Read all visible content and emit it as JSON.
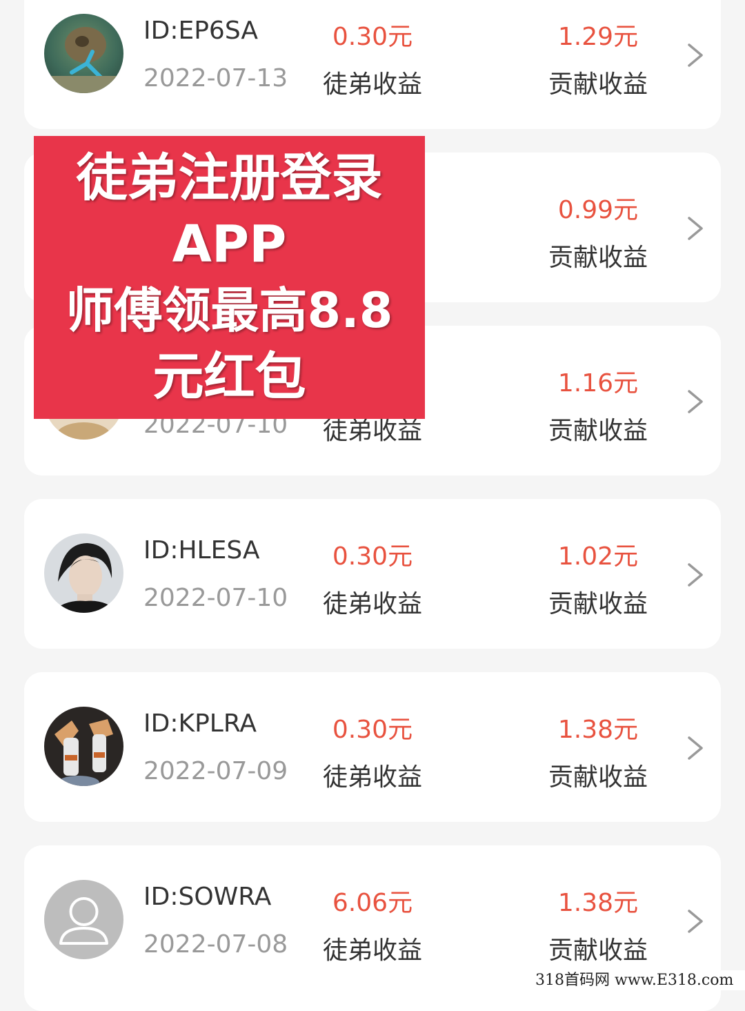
{
  "records": [
    {
      "id": "ID:EP6SA",
      "date": "2022-07-13",
      "apprentice_amount": "0.30元",
      "apprentice_label": "徒弟收益",
      "contribution_amount": "1.29元",
      "contribution_label": "贡献收益",
      "avatar": "coral-reef-photo"
    },
    {
      "id": "",
      "date": "",
      "apprentice_amount": "",
      "apprentice_label": "",
      "contribution_amount": "0.99元",
      "contribution_label": "贡献收益",
      "avatar": "hidden"
    },
    {
      "id": "",
      "date": "2022-07-10",
      "apprentice_amount": "",
      "apprentice_label": "徒弟收益",
      "contribution_amount": "1.16元",
      "contribution_label": "贡献收益",
      "avatar": "partially-hidden-photo"
    },
    {
      "id": "ID:HLESA",
      "date": "2022-07-10",
      "apprentice_amount": "0.30元",
      "apprentice_label": "徒弟收益",
      "contribution_amount": "1.02元",
      "contribution_label": "贡献收益",
      "avatar": "person-portrait-photo"
    },
    {
      "id": "ID:KPLRA",
      "date": "2022-07-09",
      "apprentice_amount": "0.30元",
      "apprentice_label": "徒弟收益",
      "contribution_amount": "1.38元",
      "contribution_label": "贡献收益",
      "avatar": "figurines-photo"
    },
    {
      "id": "ID:SOWRA",
      "date": "2022-07-08",
      "apprentice_amount": "6.06元",
      "apprentice_label": "徒弟收益",
      "contribution_amount": "1.38元",
      "contribution_label": "贡献收益",
      "avatar": "default-user-icon"
    }
  ],
  "overlay": {
    "line1": "徒弟注册登录",
    "line2": "APP",
    "line3": "师傅领最高8.8",
    "line4": "元红包"
  },
  "watermark": "318首码网  www.E318.com",
  "colors": {
    "amount": "#e8523f",
    "overlay_bg": "#e8354a",
    "card_bg": "#ffffff",
    "page_bg": "#f5f5f5"
  }
}
